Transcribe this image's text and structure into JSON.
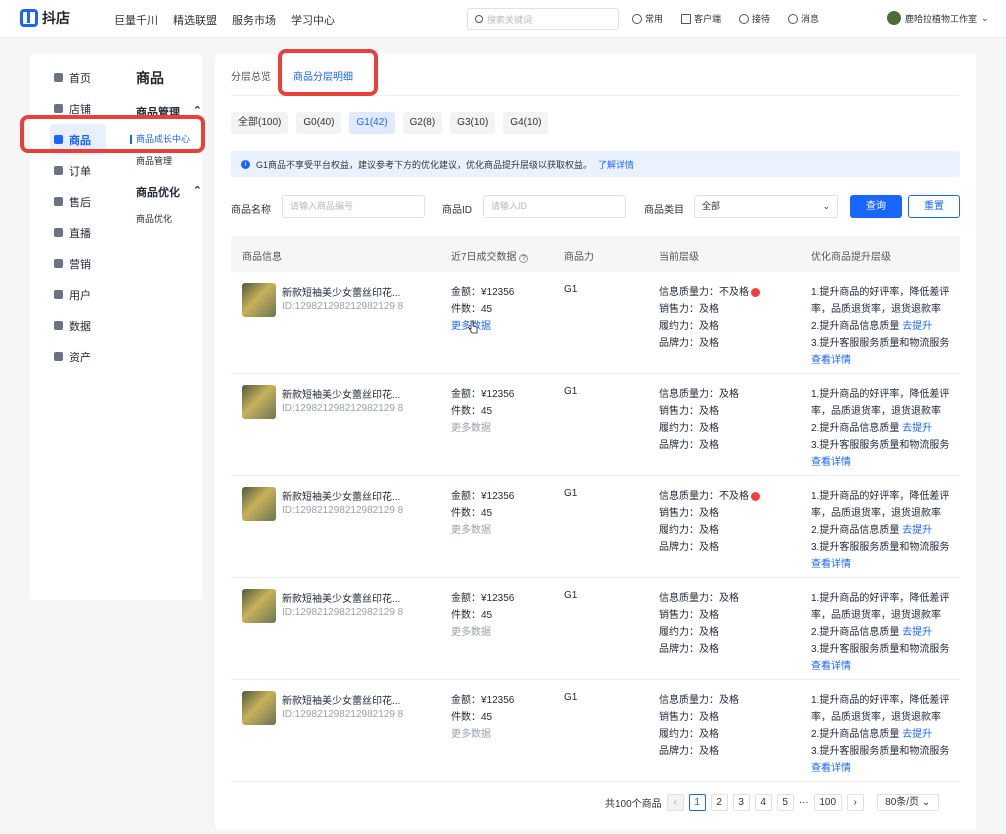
{
  "header": {
    "logo": "抖店",
    "nav": [
      "巨量千川",
      "精选联盟",
      "服务市场",
      "学习中心"
    ],
    "search_placeholder": "搜索关键词",
    "tools": [
      "常用",
      "客户端",
      "接待",
      "消息"
    ],
    "user": "鹿哈拉植物工作室"
  },
  "sidebar": {
    "items": [
      {
        "label": "首页",
        "icon": "home-icon"
      },
      {
        "label": "店铺",
        "icon": "shop-icon"
      },
      {
        "label": "商品",
        "icon": "product-icon"
      },
      {
        "label": "订单",
        "icon": "order-icon"
      },
      {
        "label": "售后",
        "icon": "after-sale-icon"
      },
      {
        "label": "直播",
        "icon": "live-icon"
      },
      {
        "label": "营销",
        "icon": "marketing-icon"
      },
      {
        "label": "用户",
        "icon": "user-icon"
      },
      {
        "label": "数据",
        "icon": "data-icon"
      },
      {
        "label": "资产",
        "icon": "asset-icon"
      }
    ],
    "active": 2
  },
  "submenu": {
    "title": "商品",
    "groups": [
      {
        "label": "商品管理",
        "items": [
          "商品成长中心",
          "商品管理"
        ]
      },
      {
        "label": "商品优化",
        "items": [
          "商品优化"
        ]
      }
    ]
  },
  "tabs": [
    "分层总览",
    "商品分层明细"
  ],
  "chips": [
    "全部(100)",
    "G0(40)",
    "G1(42)",
    "G2(8)",
    "G3(10)",
    "G4(10)"
  ],
  "notice": {
    "text": "G1商品不享受平台权益，建议参考下方的优化建议，优化商品提升层级以获取权益。",
    "link": "了解详情"
  },
  "filters": {
    "name_label": "商品名称",
    "name_ph": "请输入商品编号",
    "id_label": "商品ID",
    "id_ph": "请输入ID",
    "cat_label": "商品类目",
    "cat_value": "全部",
    "query": "查询",
    "reset": "重置"
  },
  "table": {
    "headers": [
      "商品信息",
      "近7日成交数据",
      "商品力",
      "当前层级",
      "优化商品提升层级"
    ],
    "rows": [
      {
        "name": "新款短袖美少女蕾丝印花...",
        "id": "ID:129821298212982129 8",
        "amount": "金额：¥12356",
        "count": "件数：45",
        "more": "更多数据",
        "level": "G1",
        "info": "信息质量力：不及格",
        "sales": "销售力：及格",
        "fulfill": "履约力：及格",
        "brand": "品牌力：及格",
        "tip1": "1.提升商品的好评率，降低差评率，品质退货率，退货退款率",
        "tip2": "2.提升商品信息质量",
        "tip2link": "去提升",
        "tip3": "3.提升客服服务质量和物流服务",
        "detail": "查看详情"
      },
      {
        "name": "新款短袖美少女蕾丝印花...",
        "id": "ID:129821298212982129 8",
        "amount": "金额：¥12356",
        "count": "件数：45",
        "more": "更多数据",
        "level": "G1",
        "info": "信息质量力：及格",
        "sales": "销售力：及格",
        "fulfill": "履约力：及格",
        "brand": "品牌力：及格",
        "tip1": "1.提升商品的好评率，降低差评率，品质退货率，退货退款率",
        "tip2": "2.提升商品信息质量",
        "tip2link": "去提升",
        "tip3": "3.提升客服服务质量和物流服务",
        "detail": "查看详情"
      },
      {
        "name": "新款短袖美少女蕾丝印花...",
        "id": "ID:129821298212982129 8",
        "amount": "金额：¥12356",
        "count": "件数：45",
        "more": "更多数据",
        "level": "G1",
        "info": "信息质量力：不及格",
        "sales": "销售力：及格",
        "fulfill": "履约力：及格",
        "brand": "品牌力：及格",
        "tip1": "1.提升商品的好评率，降低差评率，品质退货率，退货退款率",
        "tip2": "2.提升商品信息质量",
        "tip2link": "去提升",
        "tip3": "3.提升客服服务质量和物流服务",
        "detail": "查看详情"
      },
      {
        "name": "新款短袖美少女蕾丝印花...",
        "id": "ID:129821298212982129 8",
        "amount": "金额：¥12356",
        "count": "件数：45",
        "more": "更多数据",
        "level": "G1",
        "info": "信息质量力：及格",
        "sales": "销售力：及格",
        "fulfill": "履约力：及格",
        "brand": "品牌力：及格",
        "tip1": "1.提升商品的好评率，降低差评率，品质退货率，退货退款率",
        "tip2": "2.提升商品信息质量",
        "tip2link": "去提升",
        "tip3": "3.提升客服服务质量和物流服务",
        "detail": "查看详情"
      },
      {
        "name": "新款短袖美少女蕾丝印花...",
        "id": "ID:129821298212982129 8",
        "amount": "金额：¥12356",
        "count": "件数：45",
        "more": "更多数据",
        "level": "G1",
        "info": "信息质量力：及格",
        "sales": "销售力：及格",
        "fulfill": "履约力：及格",
        "brand": "品牌力：及格",
        "tip1": "1.提升商品的好评率，降低差评率，品质退货率，退货退款率",
        "tip2": "2.提升商品信息质量",
        "tip2link": "去提升",
        "tip3": "3.提升客服服务质量和物流服务",
        "detail": "查看详情"
      }
    ]
  },
  "pagination": {
    "total": "共100个商品",
    "pages": [
      "1",
      "2",
      "3",
      "4",
      "5",
      "···",
      "100"
    ],
    "size": "80条/页"
  },
  "accent": "#1966ff",
  "highlight": "#e8413a"
}
